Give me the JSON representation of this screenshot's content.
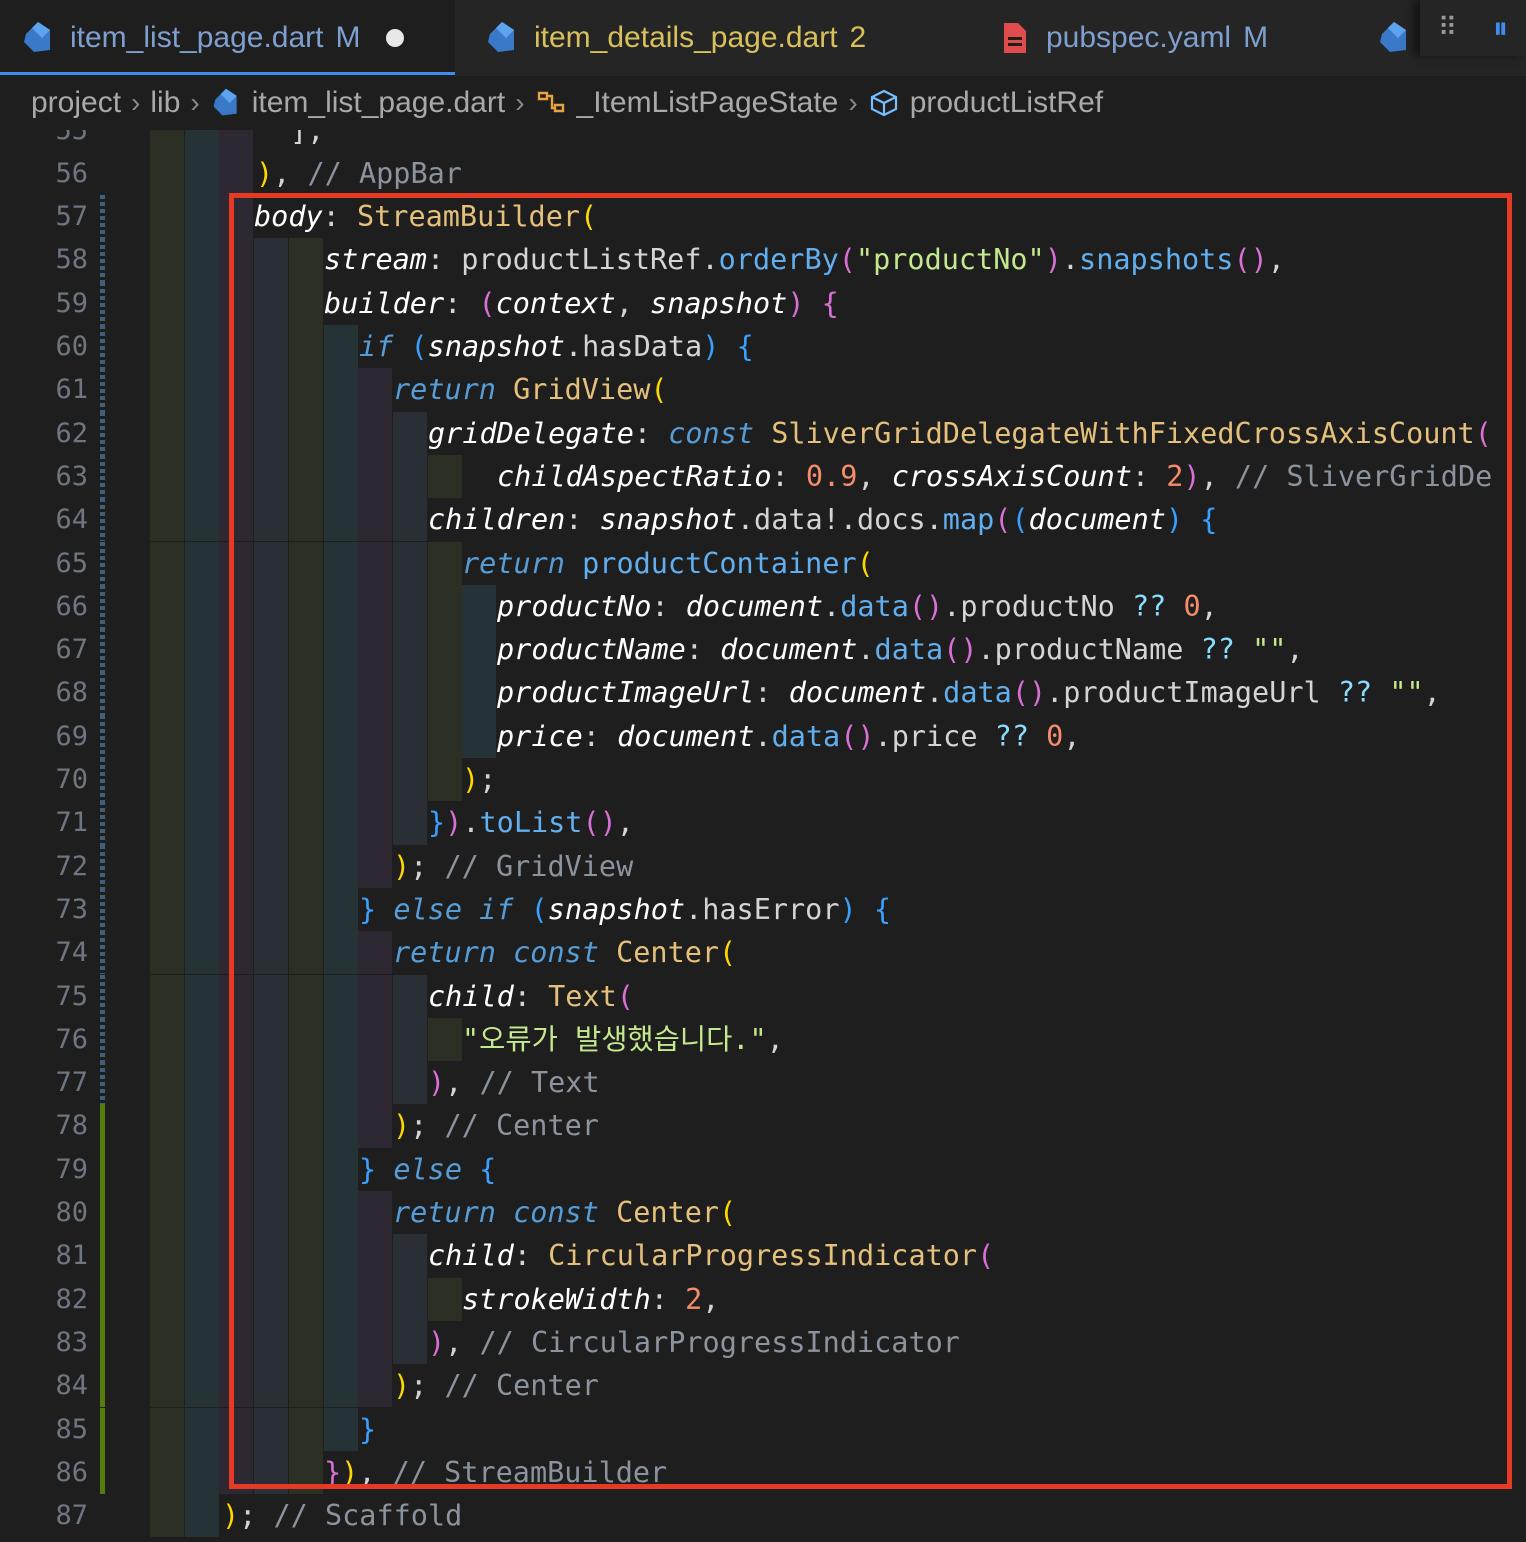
{
  "tabs": [
    {
      "name": "item_list_page.dart",
      "badge": "M",
      "active": true,
      "dirty": true,
      "icon": "dart-file-icon",
      "color": "#7f9fcf",
      "badge_color": "#7f9fcf"
    },
    {
      "name": "item_details_page.dart",
      "badge": "2",
      "active": false,
      "dirty": false,
      "icon": "dart-file-icon",
      "color": "#d8c05a",
      "badge_color": "#d8c05a"
    },
    {
      "name": "pubspec.yaml",
      "badge": "M",
      "active": false,
      "dirty": false,
      "icon": "yaml-file-icon",
      "color": "#7f9fcf",
      "badge_color": "#7f9fcf"
    }
  ],
  "toolbar_icons": [
    "drag-handle-icon",
    "pause-icon"
  ],
  "breadcrumb": {
    "project": "project",
    "lib": "lib",
    "file": "item_list_page.dart",
    "class": "_ItemListPageState",
    "member": "productListRef"
  },
  "editor": {
    "lines": [
      {
        "n": "55",
        "tokens": [
          [
            "pl",
            "],"
          ]
        ]
      },
      {
        "n": "56",
        "tokens": [
          [
            "p1",
            ")"
          ],
          [
            "pl",
            ", "
          ],
          [
            "cm",
            "// AppBar"
          ]
        ]
      },
      {
        "n": "57",
        "tokens": [
          [
            "prop",
            "body"
          ],
          [
            "pl",
            ": "
          ],
          [
            "cls",
            "StreamBuilder"
          ],
          [
            "p1",
            "("
          ]
        ]
      },
      {
        "n": "58",
        "tokens": [
          [
            "prop",
            "stream"
          ],
          [
            "pl",
            ": productListRef."
          ],
          [
            "fn",
            "orderBy"
          ],
          [
            "p2",
            "("
          ],
          [
            "str",
            "\"productNo\""
          ],
          [
            "p2",
            ")"
          ],
          [
            "pl",
            "."
          ],
          [
            "fn",
            "snapshots"
          ],
          [
            "p2",
            "()"
          ],
          [
            "pl",
            ","
          ]
        ]
      },
      {
        "n": "59",
        "tokens": [
          [
            "prop",
            "builder"
          ],
          [
            "pl",
            ": "
          ],
          [
            "p2",
            "("
          ],
          [
            "var",
            "context"
          ],
          [
            "pl",
            ", "
          ],
          [
            "var",
            "snapshot"
          ],
          [
            "p2",
            ")"
          ],
          [
            "pl",
            " "
          ],
          [
            "p2",
            "{"
          ]
        ]
      },
      {
        "n": "60",
        "tokens": [
          [
            "ctrl",
            "if"
          ],
          [
            "pl",
            " "
          ],
          [
            "p3",
            "("
          ],
          [
            "var",
            "snapshot"
          ],
          [
            "pl",
            ".hasData"
          ],
          [
            "p3",
            ")"
          ],
          [
            "pl",
            " "
          ],
          [
            "p3",
            "{"
          ]
        ]
      },
      {
        "n": "61",
        "tokens": [
          [
            "ctrl",
            "return"
          ],
          [
            "pl",
            " "
          ],
          [
            "cls",
            "GridView"
          ],
          [
            "p1",
            "("
          ]
        ]
      },
      {
        "n": "62",
        "tokens": [
          [
            "prop",
            "gridDelegate"
          ],
          [
            "pl",
            ": "
          ],
          [
            "kw",
            "const"
          ],
          [
            "pl",
            " "
          ],
          [
            "cls",
            "SliverGridDelegateWithFixedCrossAxisCount"
          ],
          [
            "p2",
            "("
          ]
        ]
      },
      {
        "n": "63",
        "tokens": [
          [
            "prop",
            "childAspectRatio"
          ],
          [
            "pl",
            ": "
          ],
          [
            "num",
            "0.9"
          ],
          [
            "pl",
            ", "
          ],
          [
            "prop",
            "crossAxisCount"
          ],
          [
            "pl",
            ": "
          ],
          [
            "num",
            "2"
          ],
          [
            "p2",
            ")"
          ],
          [
            "pl",
            ", "
          ],
          [
            "cm",
            "// SliverGridDe"
          ]
        ]
      },
      {
        "n": "64",
        "tokens": [
          [
            "prop",
            "children"
          ],
          [
            "pl",
            ": "
          ],
          [
            "var",
            "snapshot"
          ],
          [
            "pl",
            ".data!.docs."
          ],
          [
            "fn",
            "map"
          ],
          [
            "p2",
            "("
          ],
          [
            "p3",
            "("
          ],
          [
            "var",
            "document"
          ],
          [
            "p3",
            ")"
          ],
          [
            "pl",
            " "
          ],
          [
            "p3",
            "{"
          ]
        ]
      },
      {
        "n": "65",
        "tokens": [
          [
            "ctrl",
            "return"
          ],
          [
            "pl",
            " "
          ],
          [
            "fn",
            "productContainer"
          ],
          [
            "p1",
            "("
          ]
        ]
      },
      {
        "n": "66",
        "tokens": [
          [
            "prop",
            "productNo"
          ],
          [
            "pl",
            ": "
          ],
          [
            "var",
            "document"
          ],
          [
            "pl",
            "."
          ],
          [
            "fn",
            "data"
          ],
          [
            "p2",
            "()"
          ],
          [
            "pl",
            ".productNo "
          ],
          [
            "op",
            "??"
          ],
          [
            "pl",
            " "
          ],
          [
            "num",
            "0"
          ],
          [
            "pl",
            ","
          ]
        ]
      },
      {
        "n": "67",
        "tokens": [
          [
            "prop",
            "productName"
          ],
          [
            "pl",
            ": "
          ],
          [
            "var",
            "document"
          ],
          [
            "pl",
            "."
          ],
          [
            "fn",
            "data"
          ],
          [
            "p2",
            "()"
          ],
          [
            "pl",
            ".productName "
          ],
          [
            "op",
            "??"
          ],
          [
            "pl",
            " "
          ],
          [
            "str",
            "\"\""
          ],
          [
            "pl",
            ","
          ]
        ]
      },
      {
        "n": "68",
        "tokens": [
          [
            "prop",
            "productImageUrl"
          ],
          [
            "pl",
            ": "
          ],
          [
            "var",
            "document"
          ],
          [
            "pl",
            "."
          ],
          [
            "fn",
            "data"
          ],
          [
            "p2",
            "()"
          ],
          [
            "pl",
            ".productImageUrl "
          ],
          [
            "op",
            "??"
          ],
          [
            "pl",
            " "
          ],
          [
            "str",
            "\"\""
          ],
          [
            "pl",
            ","
          ]
        ]
      },
      {
        "n": "69",
        "tokens": [
          [
            "prop",
            "price"
          ],
          [
            "pl",
            ": "
          ],
          [
            "var",
            "document"
          ],
          [
            "pl",
            "."
          ],
          [
            "fn",
            "data"
          ],
          [
            "p2",
            "()"
          ],
          [
            "pl",
            ".price "
          ],
          [
            "op",
            "??"
          ],
          [
            "pl",
            " "
          ],
          [
            "num",
            "0"
          ],
          [
            "pl",
            ","
          ]
        ]
      },
      {
        "n": "70",
        "tokens": [
          [
            "p1",
            ")"
          ],
          [
            "pl",
            ";"
          ]
        ]
      },
      {
        "n": "71",
        "tokens": [
          [
            "p3",
            "}"
          ],
          [
            "p2",
            ")"
          ],
          [
            "pl",
            "."
          ],
          [
            "fn",
            "toList"
          ],
          [
            "p2",
            "()"
          ],
          [
            "pl",
            ","
          ]
        ]
      },
      {
        "n": "72",
        "tokens": [
          [
            "p1",
            ")"
          ],
          [
            "pl",
            "; "
          ],
          [
            "cm",
            "// GridView"
          ]
        ]
      },
      {
        "n": "73",
        "tokens": [
          [
            "p3",
            "}"
          ],
          [
            "pl",
            " "
          ],
          [
            "ctrl",
            "else if"
          ],
          [
            "pl",
            " "
          ],
          [
            "p3",
            "("
          ],
          [
            "var",
            "snapshot"
          ],
          [
            "pl",
            ".hasError"
          ],
          [
            "p3",
            ")"
          ],
          [
            "pl",
            " "
          ],
          [
            "p3",
            "{"
          ]
        ]
      },
      {
        "n": "74",
        "tokens": [
          [
            "ctrl",
            "return"
          ],
          [
            "pl",
            " "
          ],
          [
            "kw",
            "const"
          ],
          [
            "pl",
            " "
          ],
          [
            "cls",
            "Center"
          ],
          [
            "p1",
            "("
          ]
        ]
      },
      {
        "n": "75",
        "tokens": [
          [
            "prop",
            "child"
          ],
          [
            "pl",
            ": "
          ],
          [
            "cls",
            "Text"
          ],
          [
            "p2",
            "("
          ]
        ]
      },
      {
        "n": "76",
        "tokens": [
          [
            "str",
            "\"오류가 발생했습니다.\""
          ],
          [
            "pl",
            ","
          ]
        ]
      },
      {
        "n": "77",
        "tokens": [
          [
            "p2",
            ")"
          ],
          [
            "pl",
            ", "
          ],
          [
            "cm",
            "// Text"
          ]
        ]
      },
      {
        "n": "78",
        "tokens": [
          [
            "p1",
            ")"
          ],
          [
            "pl",
            "; "
          ],
          [
            "cm",
            "// Center"
          ]
        ]
      },
      {
        "n": "79",
        "tokens": [
          [
            "p3",
            "}"
          ],
          [
            "pl",
            " "
          ],
          [
            "ctrl",
            "else"
          ],
          [
            "pl",
            " "
          ],
          [
            "p3",
            "{"
          ]
        ]
      },
      {
        "n": "80",
        "tokens": [
          [
            "ctrl",
            "return"
          ],
          [
            "pl",
            " "
          ],
          [
            "kw",
            "const"
          ],
          [
            "pl",
            " "
          ],
          [
            "cls",
            "Center"
          ],
          [
            "p1",
            "("
          ]
        ]
      },
      {
        "n": "81",
        "tokens": [
          [
            "prop",
            "child"
          ],
          [
            "pl",
            ": "
          ],
          [
            "cls",
            "CircularProgressIndicator"
          ],
          [
            "p2",
            "("
          ]
        ]
      },
      {
        "n": "82",
        "tokens": [
          [
            "prop",
            "strokeWidth"
          ],
          [
            "pl",
            ": "
          ],
          [
            "num",
            "2"
          ],
          [
            "pl",
            ","
          ]
        ]
      },
      {
        "n": "83",
        "tokens": [
          [
            "p2",
            ")"
          ],
          [
            "pl",
            ", "
          ],
          [
            "cm",
            "// CircularProgressIndicator"
          ]
        ]
      },
      {
        "n": "84",
        "tokens": [
          [
            "p1",
            ")"
          ],
          [
            "pl",
            "; "
          ],
          [
            "cm",
            "// Center"
          ]
        ]
      },
      {
        "n": "85",
        "tokens": [
          [
            "p3",
            "}"
          ]
        ]
      },
      {
        "n": "86",
        "tokens": [
          [
            "p2",
            "}"
          ],
          [
            "p1",
            ")"
          ],
          [
            "pl",
            ", "
          ],
          [
            "cm",
            "// StreamBuilder"
          ]
        ]
      },
      {
        "n": "87",
        "tokens": [
          [
            "p1",
            ")"
          ],
          [
            "pl",
            "; "
          ],
          [
            "cm",
            "// Scaffold"
          ]
        ]
      }
    ]
  }
}
